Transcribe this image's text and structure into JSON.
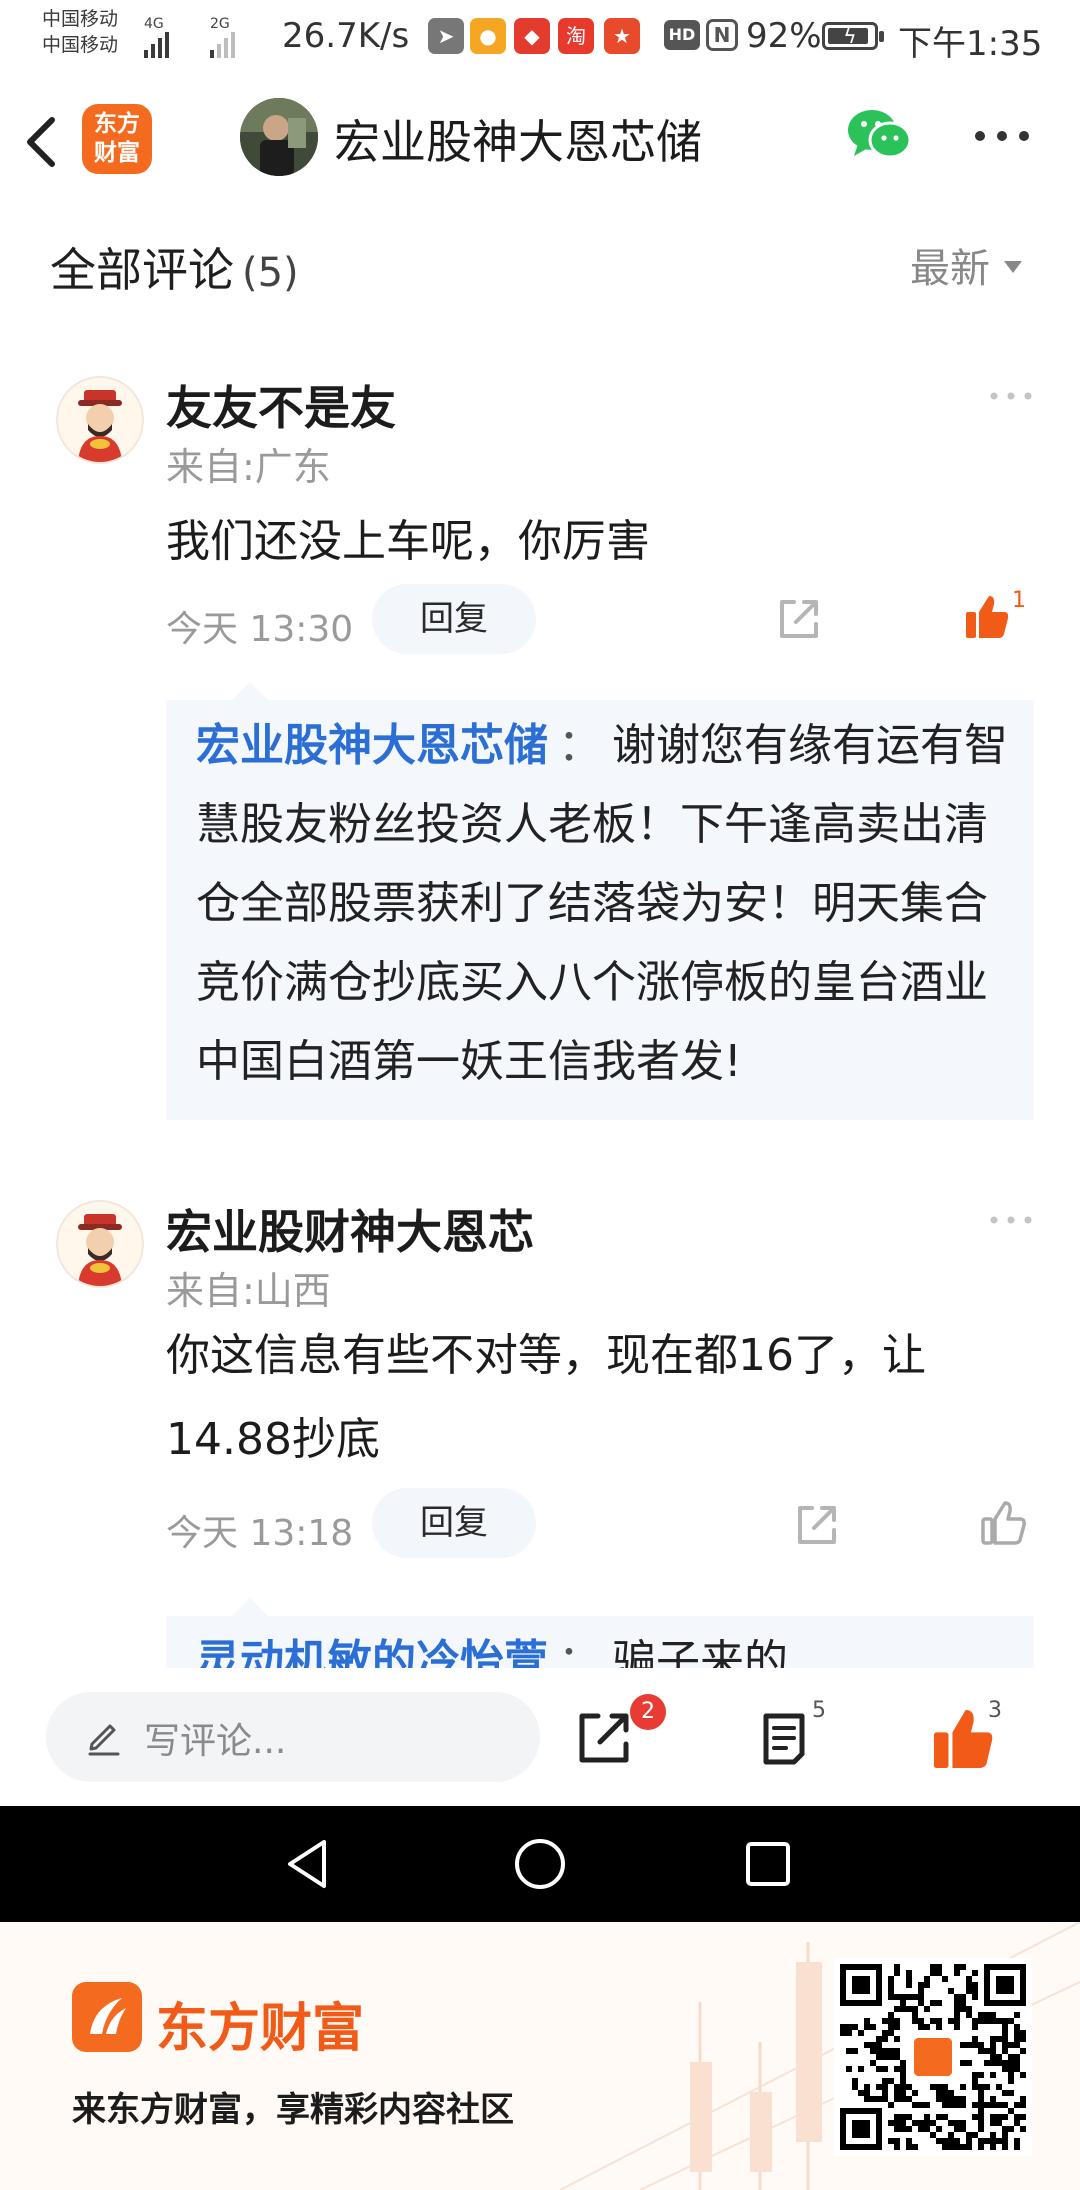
{
  "status_bar": {
    "carrier_1": "中国移动",
    "carrier_2": "中国移动",
    "net_1": "4G",
    "net_2": "2G",
    "net_speed": "26.7K/s",
    "hd": "HD",
    "nfc": "N",
    "battery_level": 0.92,
    "battery_pct": "92%",
    "time": "下午1:35"
  },
  "title_bar": {
    "brand_logo_text": "东方财富",
    "title": "宏业股神大恩芯储"
  },
  "comments_header": {
    "title": "全部评论",
    "count": "(5)",
    "sort_label": "最新"
  },
  "comments": [
    {
      "name": "友友不是友",
      "location": "来自:广东",
      "text": "我们还没上车呢，你厉害",
      "time": "今天 13:30",
      "reply_label": "回复",
      "likes": "1",
      "reply": {
        "author": "宏业股神大恩芯储",
        "sep": "：",
        "text": "谢谢您有缘有运有智慧股友粉丝投资人老板！下午逢高卖出清仓全部股票获利了结落袋为安！明天集合竞价满仓抄底买入八个涨停板的皇台酒业中国白酒第一妖王信我者发!"
      }
    },
    {
      "name": "宏业股财神大恩芯",
      "location": "来自:山西",
      "text": "你这信息有些不对等，现在都16了，让14.88抄底",
      "time": "今天 13:18",
      "reply_label": "回复",
      "reply": {
        "author": "灵动机敏的冷怡萱",
        "sep": "：",
        "text": "骗子来的"
      }
    }
  ],
  "input_bar": {
    "placeholder": "写评论...",
    "share_badge": "2",
    "comment_count": "5",
    "like_count": "3"
  },
  "promo": {
    "brand": "东方财富",
    "slogan": "来东方财富，享精彩内容社区"
  },
  "colors": {
    "brand_orange": "#f25a17",
    "link_blue": "#2b6fd6",
    "badge_red": "#e73b34"
  }
}
